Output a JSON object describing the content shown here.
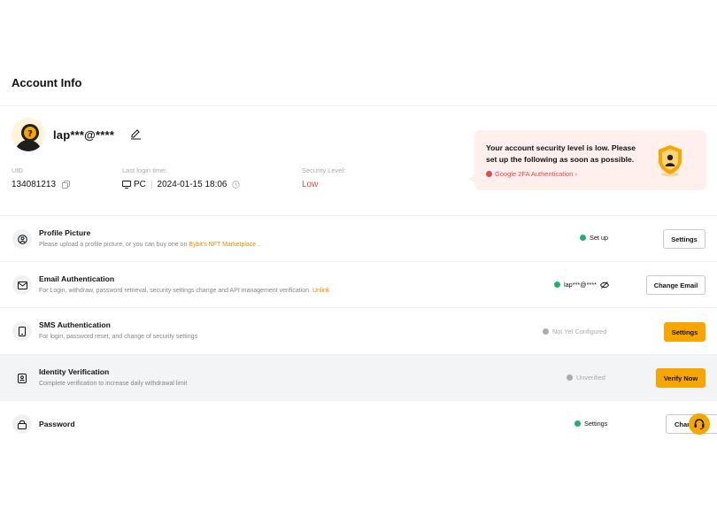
{
  "page": {
    "title": "Account Info"
  },
  "profile": {
    "username": "lap***@****",
    "uid_label": "UID",
    "uid_value": "134081213",
    "last_login_label": "Last login time:",
    "device": "PC",
    "last_login_time": "2024-01-15 18:06",
    "security_label": "Security Level:",
    "security_value": "Low"
  },
  "alert": {
    "message": "Your account security level is low. Please set up the following as soon as possible.",
    "link": "Google 2FA Authentication ›"
  },
  "settings": {
    "profile_picture": {
      "title": "Profile Picture",
      "desc": "Please upload a profile picture, or you can buy one on",
      "link": "Bybit's NFT Marketplace",
      "desc_end": ".",
      "status": "Set up",
      "button": "Settings"
    },
    "email": {
      "title": "Email Authentication",
      "desc": "For Login, withdraw, password retrieval, security settings change and API management verification.",
      "link": "Unlink",
      "status": "lap***@****",
      "button": "Change Email"
    },
    "sms": {
      "title": "SMS Authentication",
      "desc": "For login, password reset, and change of security settings",
      "status": "Not Yet Configured",
      "button": "Settings"
    },
    "identity": {
      "title": "Identity Verification",
      "desc": "Complete verification to increase daily withdrawal limit",
      "status": "Unverified",
      "button": "Verify Now"
    },
    "password": {
      "title": "Password",
      "status": "Settings",
      "button": "Chan"
    }
  },
  "colors": {
    "accent": "#f7a600",
    "danger": "#e5484d",
    "success": "#20b26c",
    "link": "#e08c00"
  },
  "icons": [
    "avatar-icon",
    "edit-icon",
    "copy-icon",
    "monitor-icon",
    "clock-icon",
    "shield-icon",
    "user-circle-icon",
    "mail-icon",
    "phone-icon",
    "id-card-icon",
    "lock-icon",
    "eye-off-icon",
    "headset-icon"
  ]
}
